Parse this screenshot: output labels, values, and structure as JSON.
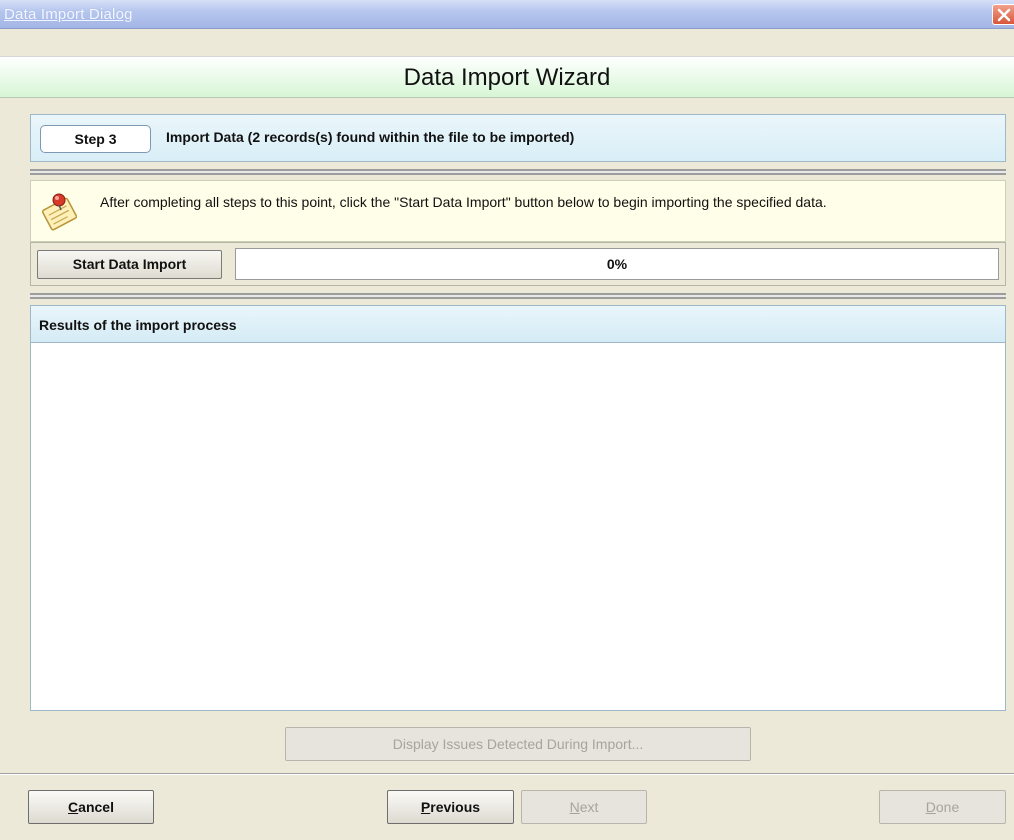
{
  "window": {
    "title": "Data Import Dialog",
    "close_icon": "close-x-icon"
  },
  "wizard": {
    "title": "Data Import Wizard"
  },
  "step": {
    "label": "Step 3",
    "description": "Import Data  (2 records(s) found within the file to be imported)"
  },
  "info": {
    "icon": "notepad-pin-icon",
    "text": "After completing all steps to this point, click the \"Start Data Import\" button below to begin importing the specified data."
  },
  "import": {
    "start_label": "Start Data Import",
    "progress_text": "0%",
    "progress_value": 0,
    "progress_color": "#3b7bd4"
  },
  "results": {
    "header": "Results of the import process",
    "content": ""
  },
  "issues_button": {
    "label": "Display Issues Detected During Import..."
  },
  "footer": {
    "cancel": {
      "mnemonic": "C",
      "rest": "ancel"
    },
    "previous": {
      "mnemonic": "P",
      "rest": "revious"
    },
    "next": {
      "mnemonic": "N",
      "rest": "ext"
    },
    "done": {
      "mnemonic": "D",
      "rest": "one"
    }
  }
}
